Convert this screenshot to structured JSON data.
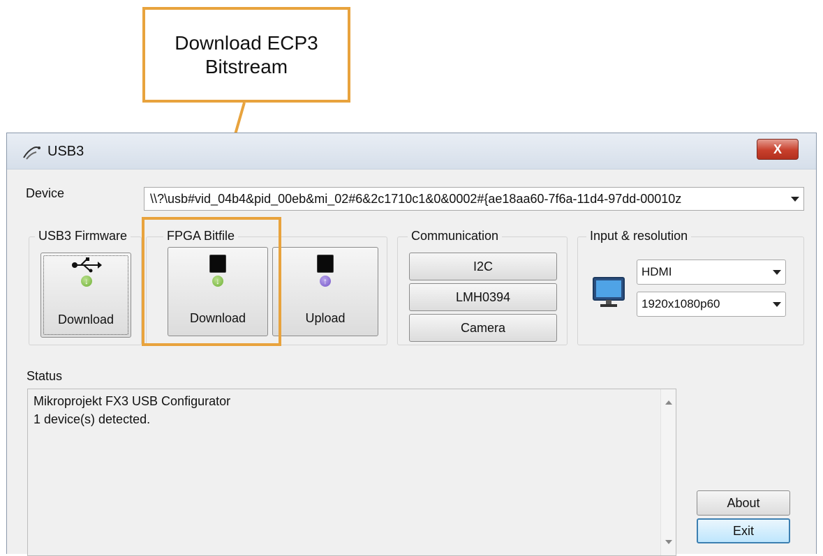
{
  "callout": {
    "text": "Download ECP3\nBitstream",
    "color": "#e8a33d"
  },
  "window": {
    "title": "USB3",
    "close_label": "X"
  },
  "device": {
    "label": "Device",
    "value": "\\\\?\\usb#vid_04b4&pid_00eb&mi_02#6&2c1710c1&0&0002#{ae18aa60-7f6a-11d4-97dd-00010z"
  },
  "usb3_firmware": {
    "title": "USB3 Firmware",
    "download_label": "Download",
    "icon": "usb-icon"
  },
  "fpga_bitfile": {
    "title": "FPGA Bitfile",
    "download_label": "Download",
    "upload_label": "Upload"
  },
  "communication": {
    "title": "Communication",
    "buttons": [
      "I2C",
      "LMH0394",
      "Camera"
    ]
  },
  "input_resolution": {
    "title": "Input & resolution",
    "input": "HDMI",
    "resolution": "1920x1080p60",
    "icon": "monitor-icon"
  },
  "status": {
    "label": "Status",
    "lines": [
      "Mikroprojekt FX3 USB Configurator",
      "1 device(s) detected."
    ]
  },
  "actions": {
    "about": "About",
    "exit": "Exit"
  }
}
